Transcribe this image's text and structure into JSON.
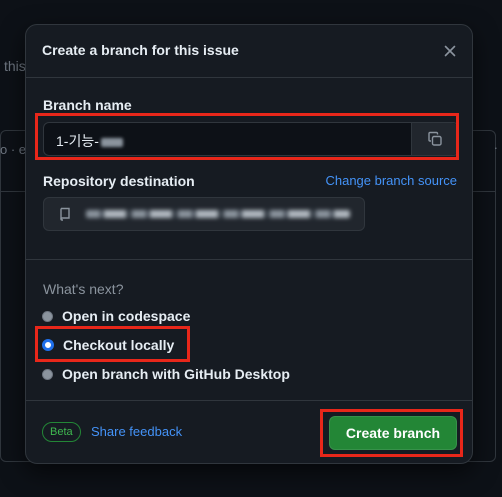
{
  "background": {
    "fragment_text": "this",
    "left_dots": "o · e",
    "right_dot": "·"
  },
  "dialog": {
    "title": "Create a branch for this issue",
    "branch_name_label": "Branch name",
    "branch_name_value": "1-기능-",
    "repo_destination_label": "Repository destination",
    "change_source_link": "Change branch source",
    "whats_next_label": "What's next?",
    "options": [
      {
        "label": "Open in codespace",
        "checked": false
      },
      {
        "label": "Checkout locally",
        "checked": true
      },
      {
        "label": "Open branch with GitHub Desktop",
        "checked": false
      }
    ],
    "beta_badge": "Beta",
    "share_feedback": "Share feedback",
    "create_button": "Create branch"
  },
  "colors": {
    "accent_blue": "#4493f8",
    "primary_green": "#238636",
    "highlight_red": "#e8271a"
  },
  "icons": [
    "close-icon",
    "copy-icon",
    "repo-icon"
  ]
}
